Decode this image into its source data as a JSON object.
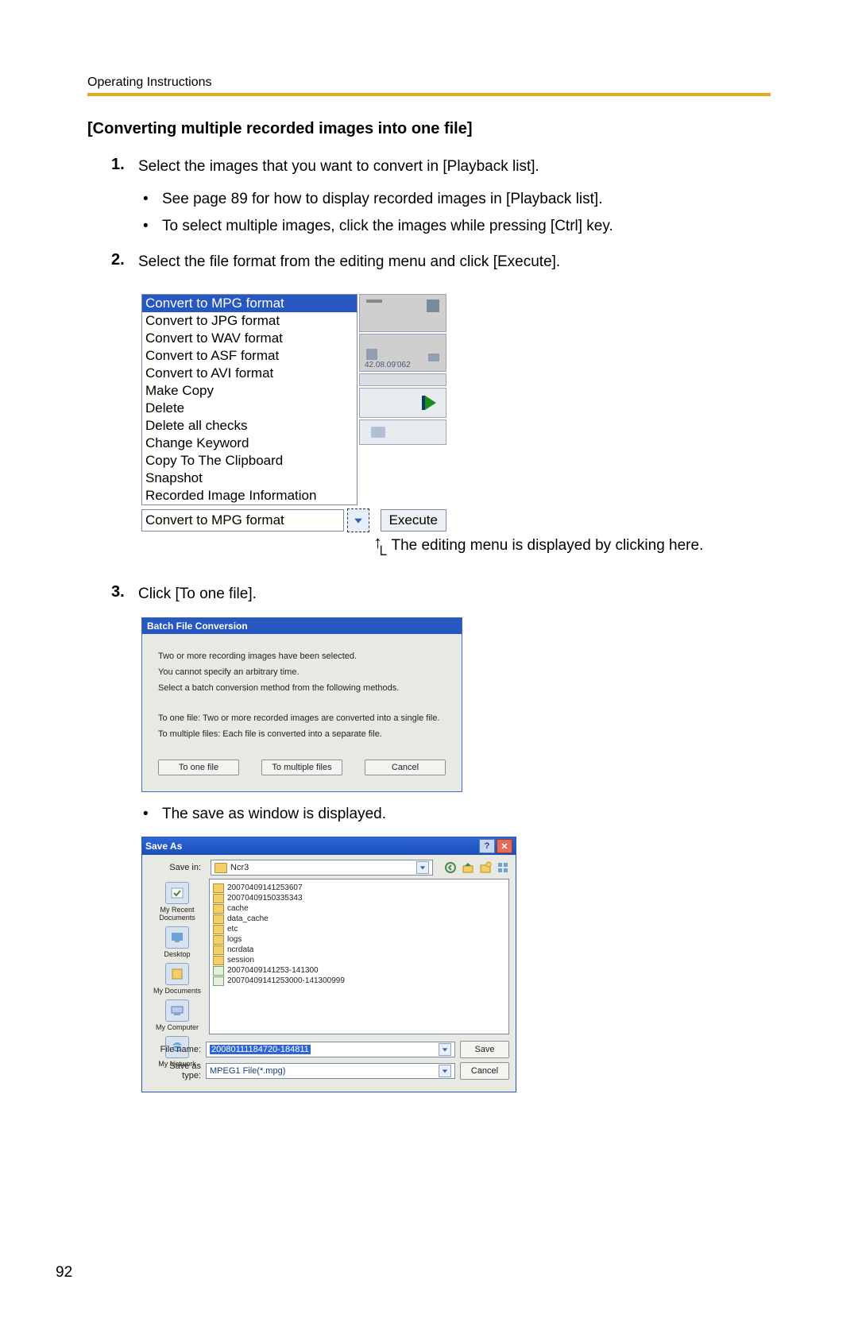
{
  "header": {
    "running": "Operating Instructions"
  },
  "title": "[Converting multiple recorded images into one file]",
  "steps": [
    {
      "num": "1.",
      "text": "Select the images that you want to convert in [Playback list].",
      "bullets": [
        "See page 89 for how to display recorded images in [Playback list].",
        "To select multiple images, click the images while pressing [Ctrl] key."
      ]
    },
    {
      "num": "2.",
      "text": "Select the file format from the editing menu and click [Execute].",
      "bullets": []
    },
    {
      "num": "3.",
      "text": "Click [To one file].",
      "bullets": []
    }
  ],
  "dropdown": {
    "items": [
      "Convert to MPG format",
      "Convert to JPG format",
      "Convert to WAV format",
      "Convert to ASF format",
      "Convert to AVI format",
      "Make Copy",
      "Delete",
      "Delete all checks",
      "Change Keyword",
      "Copy To The Clipboard",
      "Snapshot",
      "Recorded Image Information"
    ],
    "selected": "Convert to MPG format",
    "execute": "Execute",
    "thumb_ts": "42.08.09'062",
    "caption": "The editing menu is displayed by clicking here."
  },
  "batch": {
    "title": "Batch File Conversion",
    "lines": [
      "Two or more recording images have been selected.",
      "You cannot specify an arbitrary time.",
      "Select a batch conversion method from the following methods.",
      "To one file: Two or more recorded images are converted into a single file.",
      "To multiple files: Each file is converted into a separate file."
    ],
    "btn_one": "To one file",
    "btn_multi": "To multiple files",
    "btn_cancel": "Cancel"
  },
  "post_batch_bullet": "The save as window is displayed.",
  "saveas": {
    "title": "Save As",
    "savein_label": "Save in:",
    "savein_value": "Ncr3",
    "places": [
      "My Recent Documents",
      "Desktop",
      "My Documents",
      "My Computer",
      "My Network"
    ],
    "files": [
      {
        "t": "folder",
        "n": "20070409141253607"
      },
      {
        "t": "folder",
        "n": "20070409150335343"
      },
      {
        "t": "folder",
        "n": "cache"
      },
      {
        "t": "folder",
        "n": "data_cache"
      },
      {
        "t": "folder",
        "n": "etc"
      },
      {
        "t": "folder",
        "n": "logs"
      },
      {
        "t": "folder",
        "n": "ncrdata"
      },
      {
        "t": "folder",
        "n": "session"
      },
      {
        "t": "file",
        "n": "20070409141253-141300"
      },
      {
        "t": "file",
        "n": "20070409141253000-141300999"
      }
    ],
    "filename_label": "File name:",
    "filename_value": "20080111184720-184811",
    "type_label": "Save as type:",
    "type_value": "MPEG1 File(*.mpg)",
    "btn_save": "Save",
    "btn_cancel": "Cancel"
  },
  "page_number": "92"
}
